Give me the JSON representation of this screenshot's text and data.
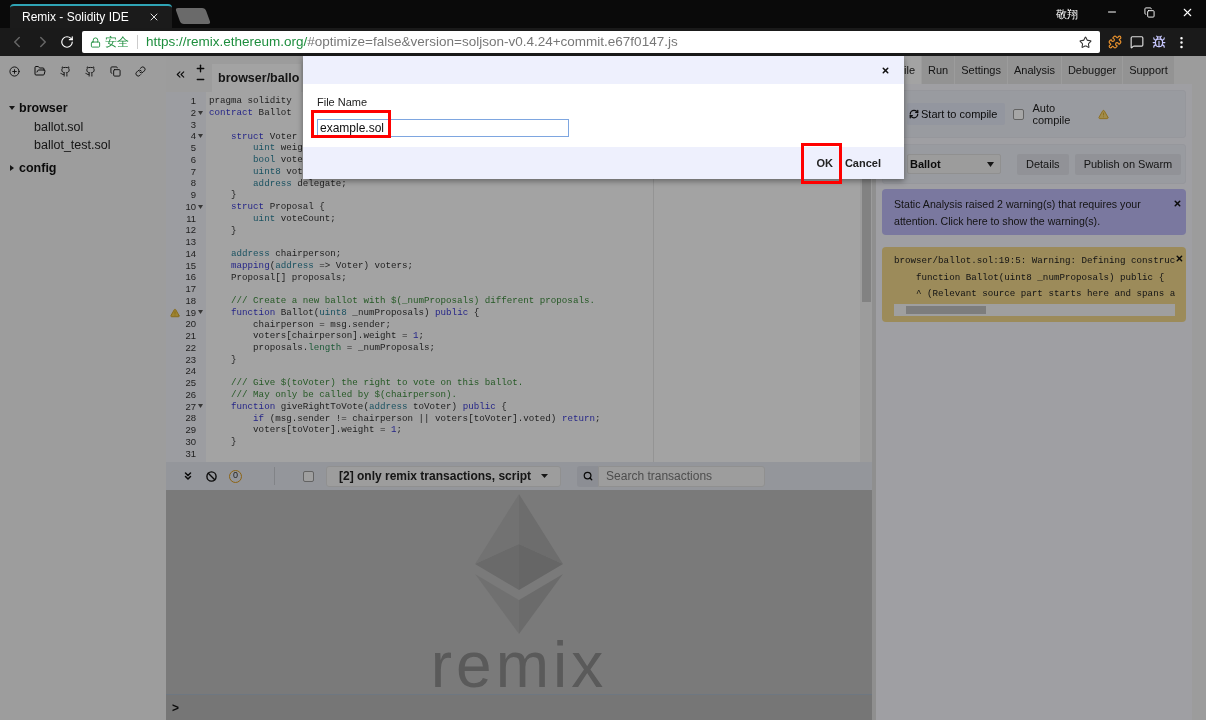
{
  "browser": {
    "tabs": [
      {
        "title": "Remix - Solidity IDE",
        "selected": true
      },
      {
        "selected": false
      }
    ],
    "user": "敬翔",
    "security_label": "安全",
    "url_host": "https://remix.ethereum.org/",
    "url_rest": "#optimize=false&version=soljson-v0.4.24+commit.e67f0147.js"
  },
  "file_tree": [
    {
      "label": "browser",
      "expanded": true,
      "children": [
        {
          "label": "ballot.sol"
        },
        {
          "label": "ballot_test.sol"
        }
      ]
    },
    {
      "label": "config",
      "expanded": false
    }
  ],
  "editor": {
    "tab": "browser/ballo",
    "lines": [
      {
        "number": "1",
        "fold": false,
        "warning": false,
        "tokens": [
          {
            "kind": "plain",
            "t": "pragma solidity"
          }
        ]
      },
      {
        "number": "2",
        "fold": true,
        "warning": false,
        "tokens": [
          {
            "kind": "kw",
            "t": "contract"
          },
          {
            "kind": "plain",
            "t": " Ballot"
          }
        ]
      },
      {
        "number": "3",
        "fold": false,
        "warning": false
      },
      {
        "number": "4",
        "fold": true,
        "warning": false,
        "tokens": [
          {
            "kind": "kw",
            "t": "    struct"
          },
          {
            "kind": "plain",
            "t": " Voter"
          }
        ]
      },
      {
        "number": "5",
        "fold": false,
        "warning": false,
        "tokens": [
          {
            "kind": "type",
            "t": "        uint"
          },
          {
            "kind": "plain",
            "t": " weig"
          }
        ]
      },
      {
        "number": "6",
        "fold": false,
        "warning": false,
        "tokens": [
          {
            "kind": "type",
            "t": "        bool"
          },
          {
            "kind": "plain",
            "t": " vote"
          }
        ]
      },
      {
        "number": "7",
        "fold": false,
        "warning": false,
        "tokens": [
          {
            "kind": "type",
            "t": "        uint8"
          },
          {
            "kind": "plain",
            "t": " vot"
          }
        ]
      },
      {
        "number": "8",
        "fold": false,
        "warning": false,
        "tokens": [
          {
            "kind": "type",
            "t": "        address"
          },
          {
            "kind": "plain",
            "t": " delegate;"
          }
        ]
      },
      {
        "number": "9",
        "fold": false,
        "warning": false,
        "tokens": [
          {
            "kind": "plain",
            "t": "    }"
          }
        ]
      },
      {
        "number": "10",
        "fold": true,
        "warning": false,
        "tokens": [
          {
            "kind": "kw",
            "t": "    struct"
          },
          {
            "kind": "plain",
            "t": " Proposal {"
          }
        ]
      },
      {
        "number": "11",
        "fold": false,
        "warning": false,
        "tokens": [
          {
            "kind": "type",
            "t": "        uint"
          },
          {
            "kind": "plain",
            "t": " voteCount;"
          }
        ]
      },
      {
        "number": "12",
        "fold": false,
        "warning": false,
        "tokens": [
          {
            "kind": "plain",
            "t": "    }"
          }
        ]
      },
      {
        "number": "13",
        "fold": false,
        "warning": false
      },
      {
        "number": "14",
        "fold": false,
        "warning": false,
        "tokens": [
          {
            "kind": "type",
            "t": "    address"
          },
          {
            "kind": "plain",
            "t": " chairperson;"
          }
        ]
      },
      {
        "number": "15",
        "fold": false,
        "warning": false,
        "tokens": [
          {
            "kind": "kw",
            "t": "    mapping"
          },
          {
            "kind": "plain",
            "t": "("
          },
          {
            "kind": "type",
            "t": "address"
          },
          {
            "kind": "plain",
            "t": " => Voter) voters;"
          }
        ]
      },
      {
        "number": "16",
        "fold": false,
        "warning": false,
        "tokens": [
          {
            "kind": "plain",
            "t": "    Proposal[] proposals;"
          }
        ]
      },
      {
        "number": "17",
        "fold": false,
        "warning": false
      },
      {
        "number": "18",
        "fold": false,
        "warning": false,
        "tokens": [
          {
            "kind": "comment",
            "t": "    /// Create a new ballot with $(_numProposals) different proposals."
          }
        ]
      },
      {
        "number": "19",
        "fold": true,
        "warning": true,
        "tokens": [
          {
            "kind": "kw",
            "t": "    function"
          },
          {
            "kind": "plain",
            "t": " Ballot("
          },
          {
            "kind": "type",
            "t": "uint8"
          },
          {
            "kind": "plain",
            "t": " _numProposals) "
          },
          {
            "kind": "kw",
            "t": "public"
          },
          {
            "kind": "plain",
            "t": " {"
          }
        ]
      },
      {
        "number": "20",
        "fold": false,
        "warning": false,
        "tokens": [
          {
            "kind": "plain",
            "t": "        chairperson = msg.sender;"
          }
        ]
      },
      {
        "number": "21",
        "fold": false,
        "warning": false,
        "tokens": [
          {
            "kind": "plain",
            "t": "        voters[chairperson].weight = "
          },
          {
            "kind": "num",
            "t": "1"
          },
          {
            "kind": "plain",
            "t": ";"
          }
        ]
      },
      {
        "number": "22",
        "fold": false,
        "warning": false,
        "tokens": [
          {
            "kind": "plain",
            "t": "        proposals."
          },
          {
            "kind": "prop",
            "t": "length"
          },
          {
            "kind": "plain",
            "t": " = _numProposals;"
          }
        ]
      },
      {
        "number": "23",
        "fold": false,
        "warning": false,
        "tokens": [
          {
            "kind": "plain",
            "t": "    }"
          }
        ]
      },
      {
        "number": "24",
        "fold": false,
        "warning": false
      },
      {
        "number": "25",
        "fold": false,
        "warning": false,
        "tokens": [
          {
            "kind": "comment",
            "t": "    /// Give $(toVoter) the right to vote on this ballot."
          }
        ]
      },
      {
        "number": "26",
        "fold": false,
        "warning": false,
        "tokens": [
          {
            "kind": "comment",
            "t": "    /// May only be called by $(chairperson)."
          }
        ]
      },
      {
        "number": "27",
        "fold": true,
        "warning": false,
        "tokens": [
          {
            "kind": "kw",
            "t": "    function"
          },
          {
            "kind": "plain",
            "t": " giveRightToVote("
          },
          {
            "kind": "type",
            "t": "address"
          },
          {
            "kind": "plain",
            "t": " toVoter) "
          },
          {
            "kind": "kw",
            "t": "public"
          },
          {
            "kind": "plain",
            "t": " {"
          }
        ]
      },
      {
        "number": "28",
        "fold": false,
        "warning": false,
        "tokens": [
          {
            "kind": "kw",
            "t": "        if"
          },
          {
            "kind": "plain",
            "t": " (msg.sender != chairperson || voters[toVoter].voted) "
          },
          {
            "kind": "kw",
            "t": "return"
          },
          {
            "kind": "plain",
            "t": ";"
          }
        ]
      },
      {
        "number": "29",
        "fold": false,
        "warning": false,
        "tokens": [
          {
            "kind": "plain",
            "t": "        voters[toVoter].weight = "
          },
          {
            "kind": "num",
            "t": "1"
          },
          {
            "kind": "plain",
            "t": ";"
          }
        ]
      },
      {
        "number": "30",
        "fold": false,
        "warning": false,
        "tokens": [
          {
            "kind": "plain",
            "t": "    }"
          }
        ]
      },
      {
        "number": "31",
        "fold": false,
        "warning": false
      }
    ]
  },
  "terminal": {
    "badge": "0",
    "filter_checked": false,
    "filter": "[2] only remix transactions, script",
    "search_placeholder": "Search transactions",
    "logo_text": "remix",
    "prompt": ">"
  },
  "right_panel": {
    "tabs": [
      {
        "label": "ile",
        "selected": true
      },
      {
        "label": "Run",
        "selected": false
      },
      {
        "label": "Settings",
        "selected": false
      },
      {
        "label": "Analysis",
        "selected": false
      },
      {
        "label": "Debugger",
        "selected": false
      },
      {
        "label": "Support",
        "selected": false
      }
    ],
    "compile_button": "Start to compile",
    "auto_compile": {
      "label": "Auto compile",
      "checked": false
    },
    "contract": "Ballot",
    "buttons": [
      "Details",
      "Publish on Swarm"
    ],
    "alerts": [
      {
        "kind": "info",
        "text": "Static Analysis raised 2 warning(s) that requires your attention. Click here to show the warning(s)."
      },
      {
        "kind": "warning",
        "lines": [
          "browser/ballot.sol:19:5: Warning: Defining construc",
          "    function Ballot(uint8 _numProposals) public {",
          "    ^ (Relevant source part starts here and spans a"
        ]
      }
    ]
  },
  "dialog": {
    "label": "File Name",
    "value": "example.sol",
    "value_highlighted": true,
    "buttons": [
      {
        "label": "OK",
        "highlighted": true
      },
      {
        "label": "Cancel",
        "highlighted": false
      }
    ]
  }
}
